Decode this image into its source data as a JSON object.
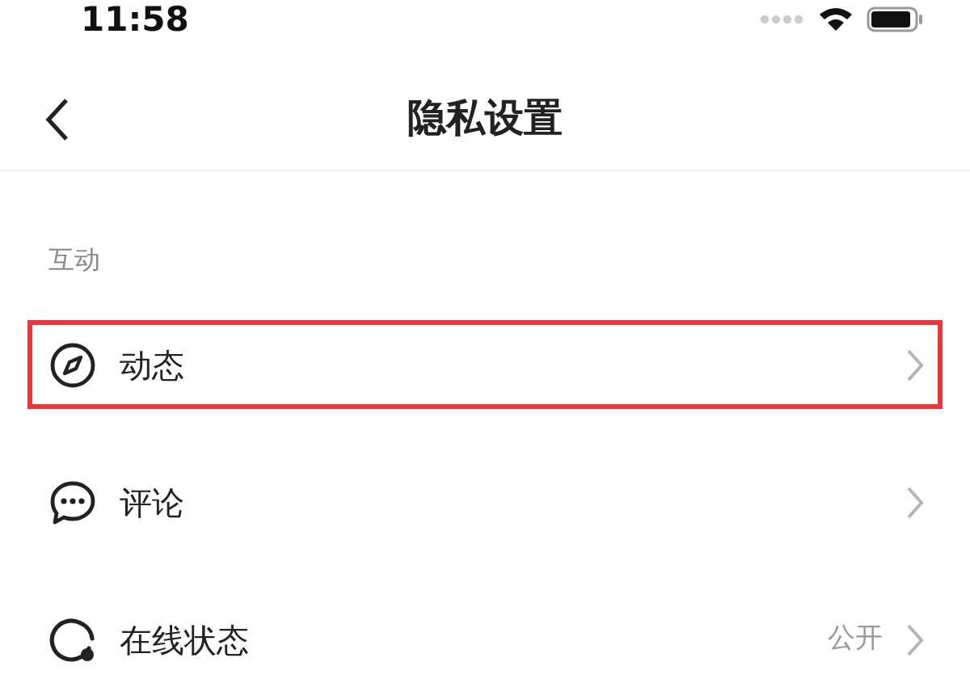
{
  "status_bar": {
    "time": "11:58"
  },
  "nav": {
    "title": "隐私设置"
  },
  "section": {
    "label": "互动"
  },
  "items": [
    {
      "label": "动态",
      "highlighted": true
    },
    {
      "label": "评论",
      "highlighted": false
    },
    {
      "label": "在线状态",
      "value": "公开",
      "highlighted": false
    }
  ]
}
